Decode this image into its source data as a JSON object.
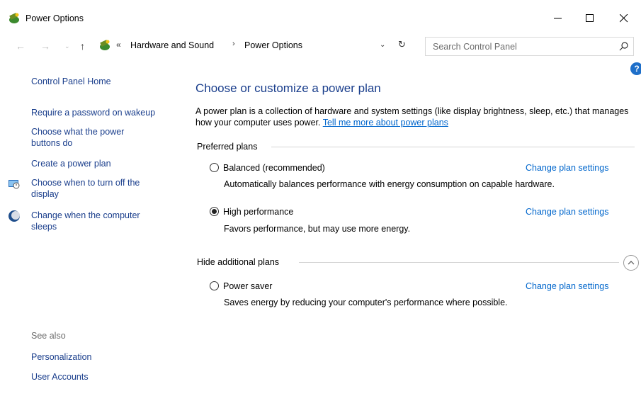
{
  "window": {
    "title": "Power Options"
  },
  "address": {
    "crumbs": [
      "Hardware and Sound",
      "Power Options"
    ],
    "search_placeholder": "Search Control Panel"
  },
  "sidebar": {
    "home": "Control Panel Home",
    "items": [
      "Require a password on wakeup",
      "Choose what the power buttons do",
      "Create a power plan",
      "Choose when to turn off the display",
      "Change when the computer sleeps"
    ],
    "see_also_label": "See also",
    "see_also": [
      "Personalization",
      "User Accounts"
    ]
  },
  "main": {
    "title": "Choose or customize a power plan",
    "description": "A power plan is a collection of hardware and system settings (like display brightness, sleep, etc.) that manages how your computer uses power.",
    "description_link": "Tell me more about power plans",
    "preferred_label": "Preferred plans",
    "hidden_label": "Hide additional plans",
    "change_link": "Change plan settings",
    "plans": [
      {
        "name": "Balanced (recommended)",
        "desc": "Automatically balances performance with energy consumption on capable hardware.",
        "selected": false
      },
      {
        "name": "High performance",
        "desc": "Favors performance, but may use more energy.",
        "selected": true
      },
      {
        "name": "Power saver",
        "desc": "Saves energy by reducing your computer's performance where possible.",
        "selected": false
      }
    ]
  },
  "colors": {
    "link": "#1a3e8c",
    "accent_link": "#0066cc",
    "help": "#1e6fc9"
  }
}
